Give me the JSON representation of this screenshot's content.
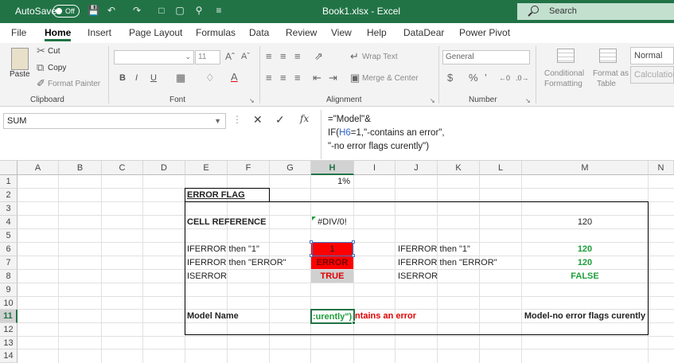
{
  "title_bar": {
    "autosave_label": "AutoSave",
    "autosave_state": "Off",
    "doc_title": "Book1.xlsx  -  Excel",
    "search_placeholder": "Search"
  },
  "menu": {
    "tabs": [
      "File",
      "Home",
      "Insert",
      "Page Layout",
      "Formulas",
      "Data",
      "Review",
      "View",
      "Help",
      "DataDear",
      "Power Pivot"
    ],
    "active": "Home"
  },
  "ribbon": {
    "clipboard": {
      "paste": "Paste",
      "cut": "Cut",
      "copy": "Copy",
      "format_painter": "Format Painter",
      "label": "Clipboard"
    },
    "font": {
      "font_size": "11",
      "bold": "B",
      "italic": "I",
      "underline": "U",
      "label": "Font"
    },
    "alignment": {
      "wrap_text": "Wrap Text",
      "merge_center": "Merge & Center",
      "label": "Alignment"
    },
    "number": {
      "format": "General",
      "label": "Number"
    },
    "styles": {
      "conditional": "Conditional",
      "formatting": "Formatting",
      "format_as": "Format as",
      "table": "Table",
      "normal": "Normal",
      "calculation": "Calculation"
    }
  },
  "formula_bar": {
    "name_box": "SUM",
    "fx": "fx",
    "formula_line1": "=\"Model\"&",
    "formula_line2_prefix": "IF(",
    "formula_line2_ref": "H6",
    "formula_line2_suffix": "=1,\"-contains an error\",",
    "formula_line3": "\"-no error flags curently\")"
  },
  "grid": {
    "columns": [
      "A",
      "B",
      "C",
      "D",
      "E",
      "F",
      "G",
      "H",
      "I",
      "J",
      "K",
      "L",
      "M",
      "N"
    ],
    "rows": [
      "1",
      "2",
      "3",
      "4",
      "5",
      "6",
      "7",
      "8",
      "9",
      "10",
      "11",
      "12",
      "13",
      "14"
    ],
    "cells": {
      "H1": "1%",
      "E2": "ERROR FLAG",
      "E4": "CELL REFERENCE",
      "H4": "#DIV/0!",
      "M4": "120",
      "E6": "IFERROR then \"1\"",
      "H6": "1",
      "J6": "IFERROR then \"1\"",
      "M6": "120",
      "E7": "IFERROR then \"ERROR\"",
      "H7": "ERROR",
      "J7": "IFERROR then \"ERROR\"",
      "M7": "120",
      "E8": "ISERROR",
      "H8": "TRUE",
      "J8": "ISERROR",
      "M8": "FALSE",
      "E11": "Model Name",
      "H11_edit": ":urently\")",
      "H11_overflow": "ntains an error",
      "M11": "Model-no error flags curently"
    },
    "colors": {
      "accent": "#217346",
      "error_fill": "#ff0000",
      "true_fill": "#d0d0d0",
      "green_text": "#1e9e3a",
      "red_text": "#e00000"
    }
  }
}
